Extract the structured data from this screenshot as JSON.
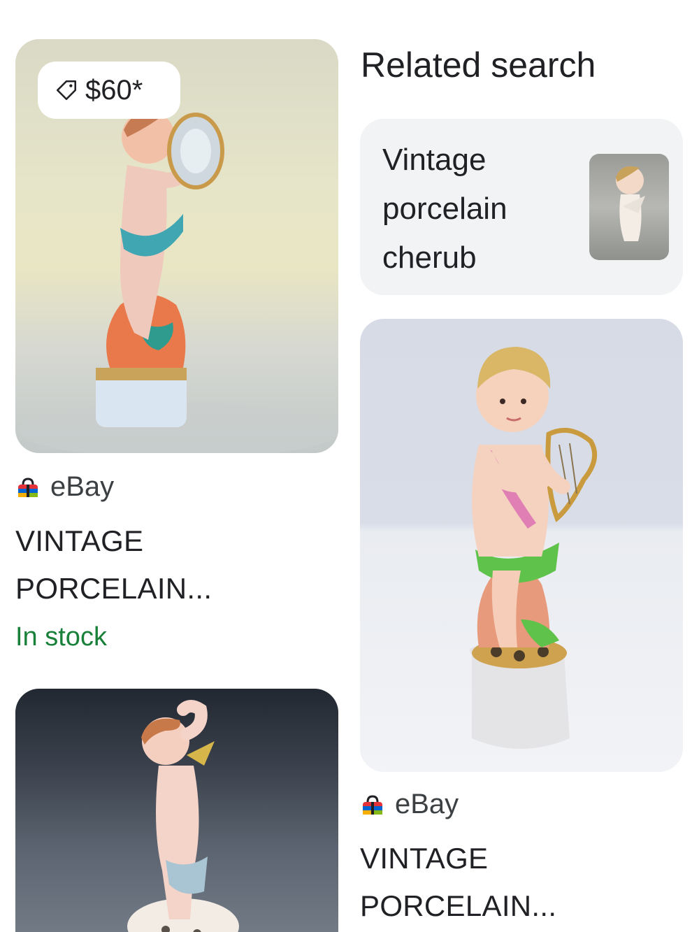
{
  "results": [
    {
      "price": "$60*",
      "source": "eBay",
      "title_line1": "VINTAGE",
      "title_line2": "PORCELAIN...",
      "stock": "In stock"
    },
    {
      "source": "eBay",
      "title_line1": "VINTAGE",
      "title_line2": "PORCELAIN..."
    }
  ],
  "related": {
    "heading": "Related search",
    "query_line1": "Vintage",
    "query_line2": "porcelain",
    "query_line3": "cherub"
  },
  "icons": {
    "price_tag": "price-tag-icon",
    "source": "ebay-logo-icon"
  },
  "colors": {
    "stock_green": "#188038",
    "chip_background": "#f1f3f4"
  }
}
